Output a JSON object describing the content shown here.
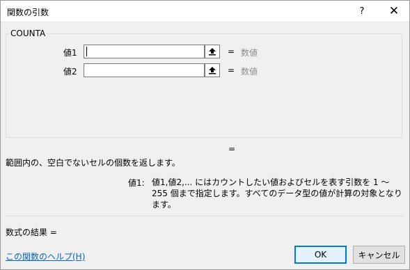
{
  "window": {
    "title": "関数の引数",
    "help_glyph": "?",
    "close_glyph": "✕"
  },
  "function": {
    "name": "COUNTA",
    "args": [
      {
        "label": "値1",
        "value": "",
        "equals": "=",
        "result": "数値"
      },
      {
        "label": "値2",
        "value": "",
        "equals": "=",
        "result": "数値"
      }
    ],
    "result_equals": "=",
    "description": "範囲内の、空白でないセルの個数を返します。",
    "arg_help": {
      "label": "値1:",
      "text": "値1,値2,... にはカウントしたい値およびセルを表す引数を 1 ～ 255 個まで指定します。すべてのデータ型の値が計算の対象となります。"
    }
  },
  "footer": {
    "formula_result": "数式の結果 =",
    "help_link": "この関数のヘルプ(H)",
    "ok_label": "OK",
    "cancel_label": "キャンセル"
  },
  "icons": {
    "ref_button_icon": "collapse-dialog-icon"
  }
}
